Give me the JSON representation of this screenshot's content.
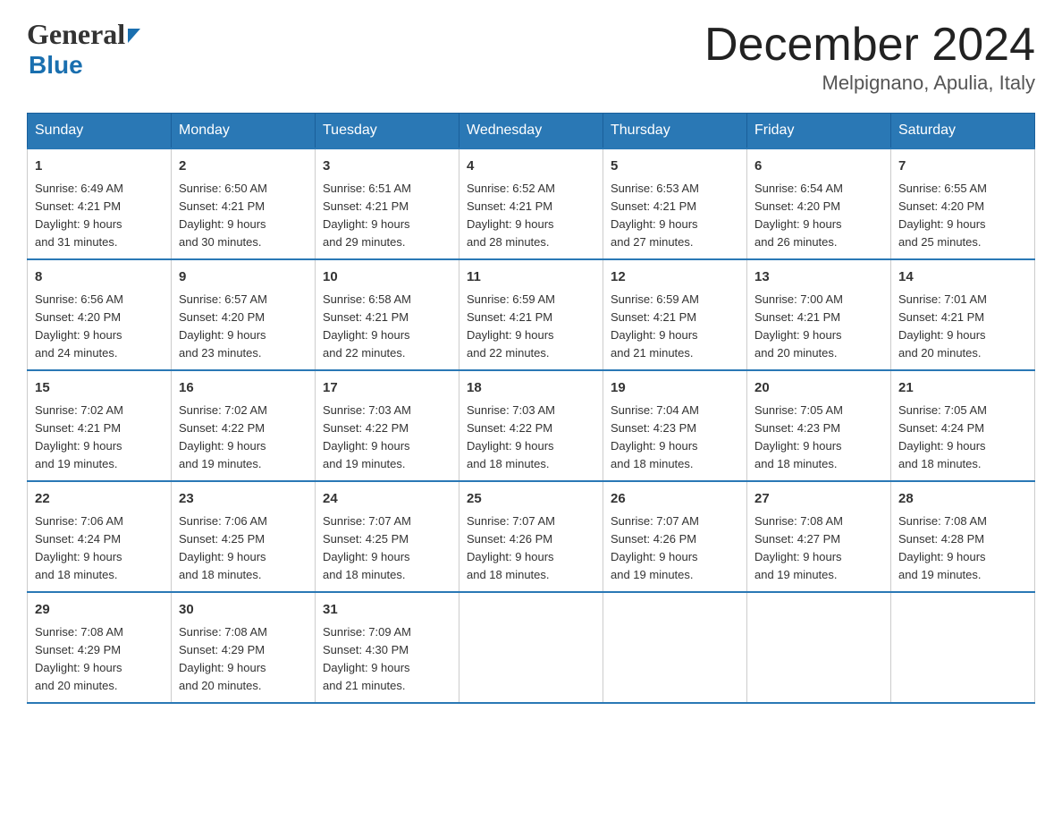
{
  "header": {
    "logo_general": "General",
    "logo_blue": "Blue",
    "title": "December 2024",
    "subtitle": "Melpignano, Apulia, Italy"
  },
  "days_of_week": [
    "Sunday",
    "Monday",
    "Tuesday",
    "Wednesday",
    "Thursday",
    "Friday",
    "Saturday"
  ],
  "weeks": [
    [
      {
        "day": "1",
        "sunrise": "6:49 AM",
        "sunset": "4:21 PM",
        "daylight": "9 hours and 31 minutes."
      },
      {
        "day": "2",
        "sunrise": "6:50 AM",
        "sunset": "4:21 PM",
        "daylight": "9 hours and 30 minutes."
      },
      {
        "day": "3",
        "sunrise": "6:51 AM",
        "sunset": "4:21 PM",
        "daylight": "9 hours and 29 minutes."
      },
      {
        "day": "4",
        "sunrise": "6:52 AM",
        "sunset": "4:21 PM",
        "daylight": "9 hours and 28 minutes."
      },
      {
        "day": "5",
        "sunrise": "6:53 AM",
        "sunset": "4:21 PM",
        "daylight": "9 hours and 27 minutes."
      },
      {
        "day": "6",
        "sunrise": "6:54 AM",
        "sunset": "4:20 PM",
        "daylight": "9 hours and 26 minutes."
      },
      {
        "day": "7",
        "sunrise": "6:55 AM",
        "sunset": "4:20 PM",
        "daylight": "9 hours and 25 minutes."
      }
    ],
    [
      {
        "day": "8",
        "sunrise": "6:56 AM",
        "sunset": "4:20 PM",
        "daylight": "9 hours and 24 minutes."
      },
      {
        "day": "9",
        "sunrise": "6:57 AM",
        "sunset": "4:20 PM",
        "daylight": "9 hours and 23 minutes."
      },
      {
        "day": "10",
        "sunrise": "6:58 AM",
        "sunset": "4:21 PM",
        "daylight": "9 hours and 22 minutes."
      },
      {
        "day": "11",
        "sunrise": "6:59 AM",
        "sunset": "4:21 PM",
        "daylight": "9 hours and 22 minutes."
      },
      {
        "day": "12",
        "sunrise": "6:59 AM",
        "sunset": "4:21 PM",
        "daylight": "9 hours and 21 minutes."
      },
      {
        "day": "13",
        "sunrise": "7:00 AM",
        "sunset": "4:21 PM",
        "daylight": "9 hours and 20 minutes."
      },
      {
        "day": "14",
        "sunrise": "7:01 AM",
        "sunset": "4:21 PM",
        "daylight": "9 hours and 20 minutes."
      }
    ],
    [
      {
        "day": "15",
        "sunrise": "7:02 AM",
        "sunset": "4:21 PM",
        "daylight": "9 hours and 19 minutes."
      },
      {
        "day": "16",
        "sunrise": "7:02 AM",
        "sunset": "4:22 PM",
        "daylight": "9 hours and 19 minutes."
      },
      {
        "day": "17",
        "sunrise": "7:03 AM",
        "sunset": "4:22 PM",
        "daylight": "9 hours and 19 minutes."
      },
      {
        "day": "18",
        "sunrise": "7:03 AM",
        "sunset": "4:22 PM",
        "daylight": "9 hours and 18 minutes."
      },
      {
        "day": "19",
        "sunrise": "7:04 AM",
        "sunset": "4:23 PM",
        "daylight": "9 hours and 18 minutes."
      },
      {
        "day": "20",
        "sunrise": "7:05 AM",
        "sunset": "4:23 PM",
        "daylight": "9 hours and 18 minutes."
      },
      {
        "day": "21",
        "sunrise": "7:05 AM",
        "sunset": "4:24 PM",
        "daylight": "9 hours and 18 minutes."
      }
    ],
    [
      {
        "day": "22",
        "sunrise": "7:06 AM",
        "sunset": "4:24 PM",
        "daylight": "9 hours and 18 minutes."
      },
      {
        "day": "23",
        "sunrise": "7:06 AM",
        "sunset": "4:25 PM",
        "daylight": "9 hours and 18 minutes."
      },
      {
        "day": "24",
        "sunrise": "7:07 AM",
        "sunset": "4:25 PM",
        "daylight": "9 hours and 18 minutes."
      },
      {
        "day": "25",
        "sunrise": "7:07 AM",
        "sunset": "4:26 PM",
        "daylight": "9 hours and 18 minutes."
      },
      {
        "day": "26",
        "sunrise": "7:07 AM",
        "sunset": "4:26 PM",
        "daylight": "9 hours and 19 minutes."
      },
      {
        "day": "27",
        "sunrise": "7:08 AM",
        "sunset": "4:27 PM",
        "daylight": "9 hours and 19 minutes."
      },
      {
        "day": "28",
        "sunrise": "7:08 AM",
        "sunset": "4:28 PM",
        "daylight": "9 hours and 19 minutes."
      }
    ],
    [
      {
        "day": "29",
        "sunrise": "7:08 AM",
        "sunset": "4:29 PM",
        "daylight": "9 hours and 20 minutes."
      },
      {
        "day": "30",
        "sunrise": "7:08 AM",
        "sunset": "4:29 PM",
        "daylight": "9 hours and 20 minutes."
      },
      {
        "day": "31",
        "sunrise": "7:09 AM",
        "sunset": "4:30 PM",
        "daylight": "9 hours and 21 minutes."
      },
      null,
      null,
      null,
      null
    ]
  ],
  "labels": {
    "sunrise": "Sunrise: ",
    "sunset": "Sunset: ",
    "daylight": "Daylight: "
  }
}
